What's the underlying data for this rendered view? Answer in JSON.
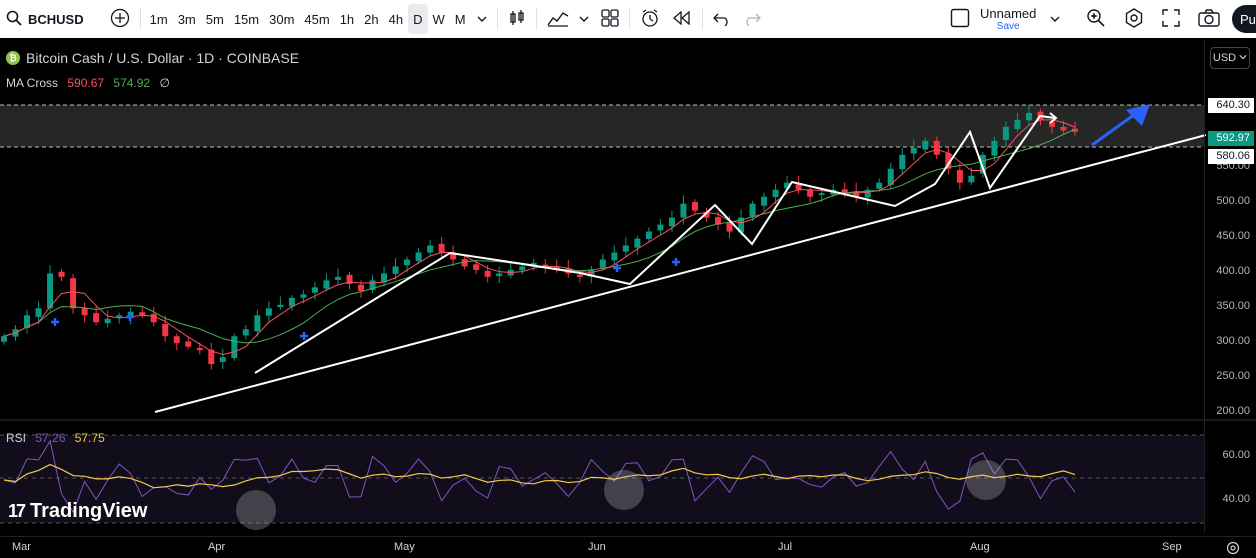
{
  "toolbar": {
    "symbol": "BCHUSD",
    "timeframes": [
      "1m",
      "3m",
      "5m",
      "15m",
      "30m",
      "45m",
      "1h",
      "2h",
      "4h",
      "D",
      "W",
      "M"
    ],
    "active_timeframe": "D",
    "layout_name": "Unnamed",
    "save_label": "Save",
    "publish_label": "Pu"
  },
  "legend": {
    "title": "Bitcoin Cash / U.S. Dollar · 1D · COINBASE",
    "ma_label": "MA Cross",
    "ma_value1": "590.67",
    "ma_value2": "574.92",
    "ma_symbol": "∅",
    "rsi_label": "RSI",
    "rsi_value1": "57.26",
    "rsi_value2": "57.75"
  },
  "price_axis": {
    "currency": "USD",
    "labels": [
      "550.00",
      "500.00",
      "450.00",
      "400.00",
      "350.00",
      "300.00",
      "250.00",
      "200.00"
    ],
    "tags": [
      {
        "value": "640.30",
        "bg": "#ffffff",
        "fg": "#131722"
      },
      {
        "value": "592.97",
        "bg": "#089981",
        "fg": "#ffffff"
      },
      {
        "value": "580.06",
        "bg": "#ffffff",
        "fg": "#131722"
      }
    ],
    "rsi_labels": [
      "60.00",
      "40.00"
    ]
  },
  "time_axis": {
    "labels": [
      "Mar",
      "Apr",
      "May",
      "Jun",
      "Jul",
      "Aug",
      "Sep"
    ]
  },
  "watermark": {
    "logo": "17",
    "text": "TradingView"
  },
  "colors": {
    "up": "#089981",
    "down": "#f23645",
    "ma_fast": "#f7525f",
    "ma_slow": "#4caf50",
    "rsi": "#7e57c2",
    "rsi_ma": "#f2c84b",
    "arrow": "#2962ff"
  },
  "chart_data": {
    "type": "candlestick",
    "symbol": "BCHUSD",
    "timeframe": "1D",
    "ylim": [
      200,
      650
    ],
    "resistance_zone": [
      580.06,
      640.3
    ],
    "last_price": 592.97,
    "close_approx": [
      300,
      310,
      330,
      340,
      390,
      385,
      340,
      330,
      320,
      325,
      330,
      335,
      330,
      320,
      300,
      290,
      285,
      280,
      260,
      270,
      300,
      310,
      330,
      340,
      345,
      355,
      360,
      370,
      380,
      385,
      375,
      365,
      380,
      390,
      400,
      410,
      420,
      430,
      420,
      410,
      400,
      395,
      385,
      390,
      395,
      400,
      405,
      400,
      395,
      390,
      385,
      395,
      410,
      420,
      430,
      440,
      450,
      460,
      470,
      490,
      480,
      470,
      460,
      450,
      470,
      490,
      500,
      510,
      520,
      510,
      500,
      505,
      510,
      505,
      500,
      510,
      520,
      540,
      560,
      570,
      580,
      560,
      540,
      520,
      530,
      560,
      580,
      600,
      610,
      620,
      610,
      600,
      595,
      593
    ],
    "rsi_range": [
      20,
      80
    ],
    "rsi_levels": [
      70,
      50,
      30
    ]
  }
}
